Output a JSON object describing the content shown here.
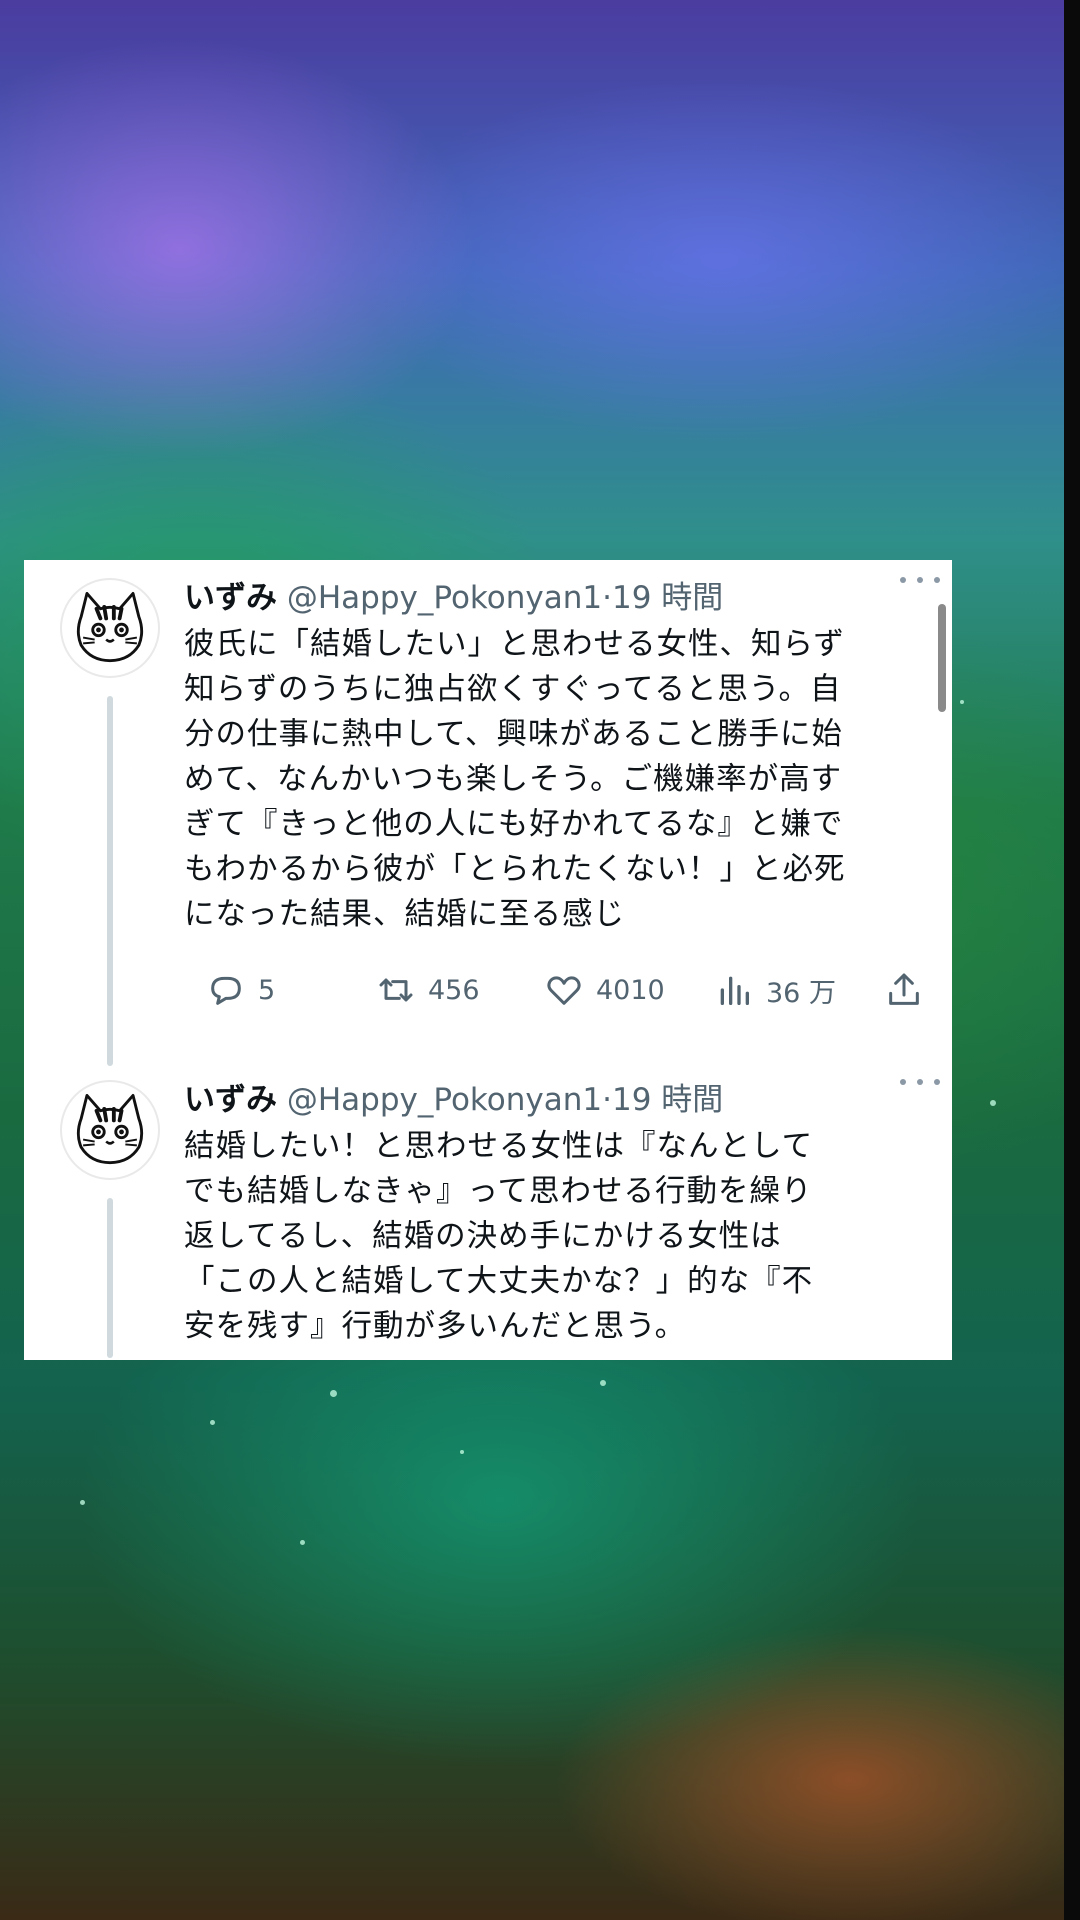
{
  "tweets": [
    {
      "name": "いずみ",
      "handle": "@Happy_Pokonyan1",
      "separator": "·",
      "time": "19 時間",
      "text": "彼氏に「結婚したい」と思わせる女性、知らず\n知らずのうちに独占欲くすぐってると思う。自\n分の仕事に熱中して、興味があること勝手に始\nめて、なんかいつも楽しそう。ご機嫌率が高す\nぎて『きっと他の人にも好かれてるな』と嫌で\nもわかるから彼が「とられたくない！」と必死\nになった結果、結婚に至る感じ",
      "replies": "5",
      "retweets": "456",
      "likes": "4010",
      "views": "36 万"
    },
    {
      "name": "いずみ",
      "handle": "@Happy_Pokonyan1",
      "separator": "·",
      "time": "19 時間",
      "text": "結婚したい！と思わせる女性は『なんとして\nでも結婚しなきゃ』って思わせる行動を繰り\n返してるし、結婚の決め手にかける女性は\n「この人と結婚して大丈夫かな？」的な『不\n安を残す』行動が多いんだと思う。"
    }
  ],
  "icons": {
    "avatar": "cat-avatar-icon",
    "more": "more-dots-icon",
    "reply": "reply-icon",
    "retweet": "retweet-icon",
    "like": "heart-icon",
    "views": "views-icon",
    "share": "share-icon"
  },
  "colors": {
    "text": "#0f1419",
    "secondary": "#536471",
    "thread_line": "#cfd9de",
    "card_bg": "#ffffff"
  }
}
